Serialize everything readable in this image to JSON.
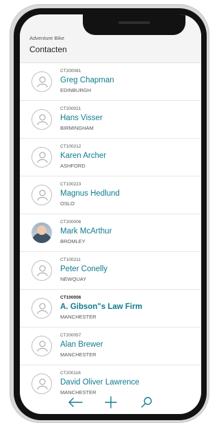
{
  "app": {
    "company": "Adventure Bike",
    "title": "Contacten"
  },
  "contacts": [
    {
      "code": "CT200081",
      "name": "Greg Chapman",
      "city": "EDINBURGH",
      "avatar": "person-icon"
    },
    {
      "code": "CT200021",
      "name": "Hans Visser",
      "city": "BIRMINGHAM",
      "avatar": "person-icon"
    },
    {
      "code": "CT100212",
      "name": "Karen Archer",
      "city": "ASHFORD",
      "avatar": "person-icon"
    },
    {
      "code": "CT100223",
      "name": "Magnus Hedlund",
      "city": "OSLO",
      "avatar": "person-icon"
    },
    {
      "code": "CT200006",
      "name": "Mark McArthur",
      "city": "BROMLEY",
      "avatar": "photo"
    },
    {
      "code": "CT100211",
      "name": "Peter Conelly",
      "city": "NEWQUAY",
      "avatar": "person-icon"
    },
    {
      "code": "CT100006",
      "name": "A. Gibson\"s Law Firm",
      "city": "MANCHESTER",
      "avatar": "person-icon",
      "bold": true
    },
    {
      "code": "CT200057",
      "name": "Alan Brewer",
      "city": "MANCHESTER",
      "avatar": "person-icon"
    },
    {
      "code": "CT200116",
      "name": "David Oliver Lawrence",
      "city": "MANCHESTER",
      "avatar": "person-icon"
    }
  ],
  "footer": {
    "back_icon": "arrow-left-icon",
    "add_icon": "plus-icon",
    "search_icon": "search-icon",
    "accent": "#0f7c8e"
  }
}
